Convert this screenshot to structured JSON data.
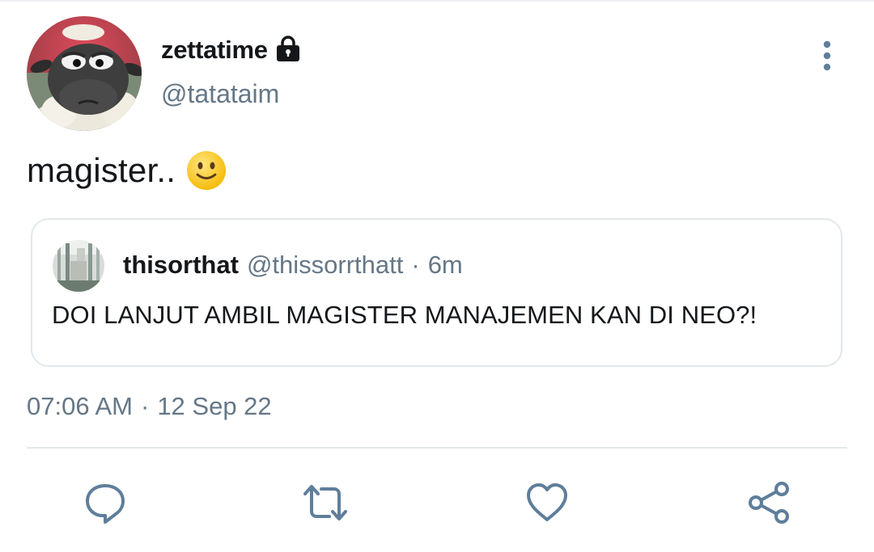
{
  "tweet": {
    "author": {
      "display_name": "zettatime",
      "handle": "@tatataim",
      "protected_icon": "lock-icon",
      "avatar_icon": "sheep-avatar"
    },
    "text": "magister..",
    "emoji": "slightly-smiling-face-icon",
    "timestamp": {
      "time": "07:06 AM",
      "separator": "·",
      "date": "12 Sep 22"
    },
    "quoted": {
      "display_name": "thisorthat",
      "handle": "@thissorrthatt",
      "separator": "·",
      "relative_time": "6m",
      "text": "DOI LANJUT AMBIL MAGISTER MANAJEMEN KAN DI NEO?!"
    }
  },
  "actions": [
    {
      "name": "reply",
      "icon": "reply-icon"
    },
    {
      "name": "retweet",
      "icon": "retweet-icon"
    },
    {
      "name": "like",
      "icon": "heart-icon"
    },
    {
      "name": "share",
      "icon": "share-icon"
    }
  ],
  "more_menu_icon": "more-vertical-icon",
  "colors": {
    "text_primary": "#14171a",
    "text_secondary": "#657786",
    "icon": "#5f7e9a",
    "border": "#e3e7ea"
  }
}
